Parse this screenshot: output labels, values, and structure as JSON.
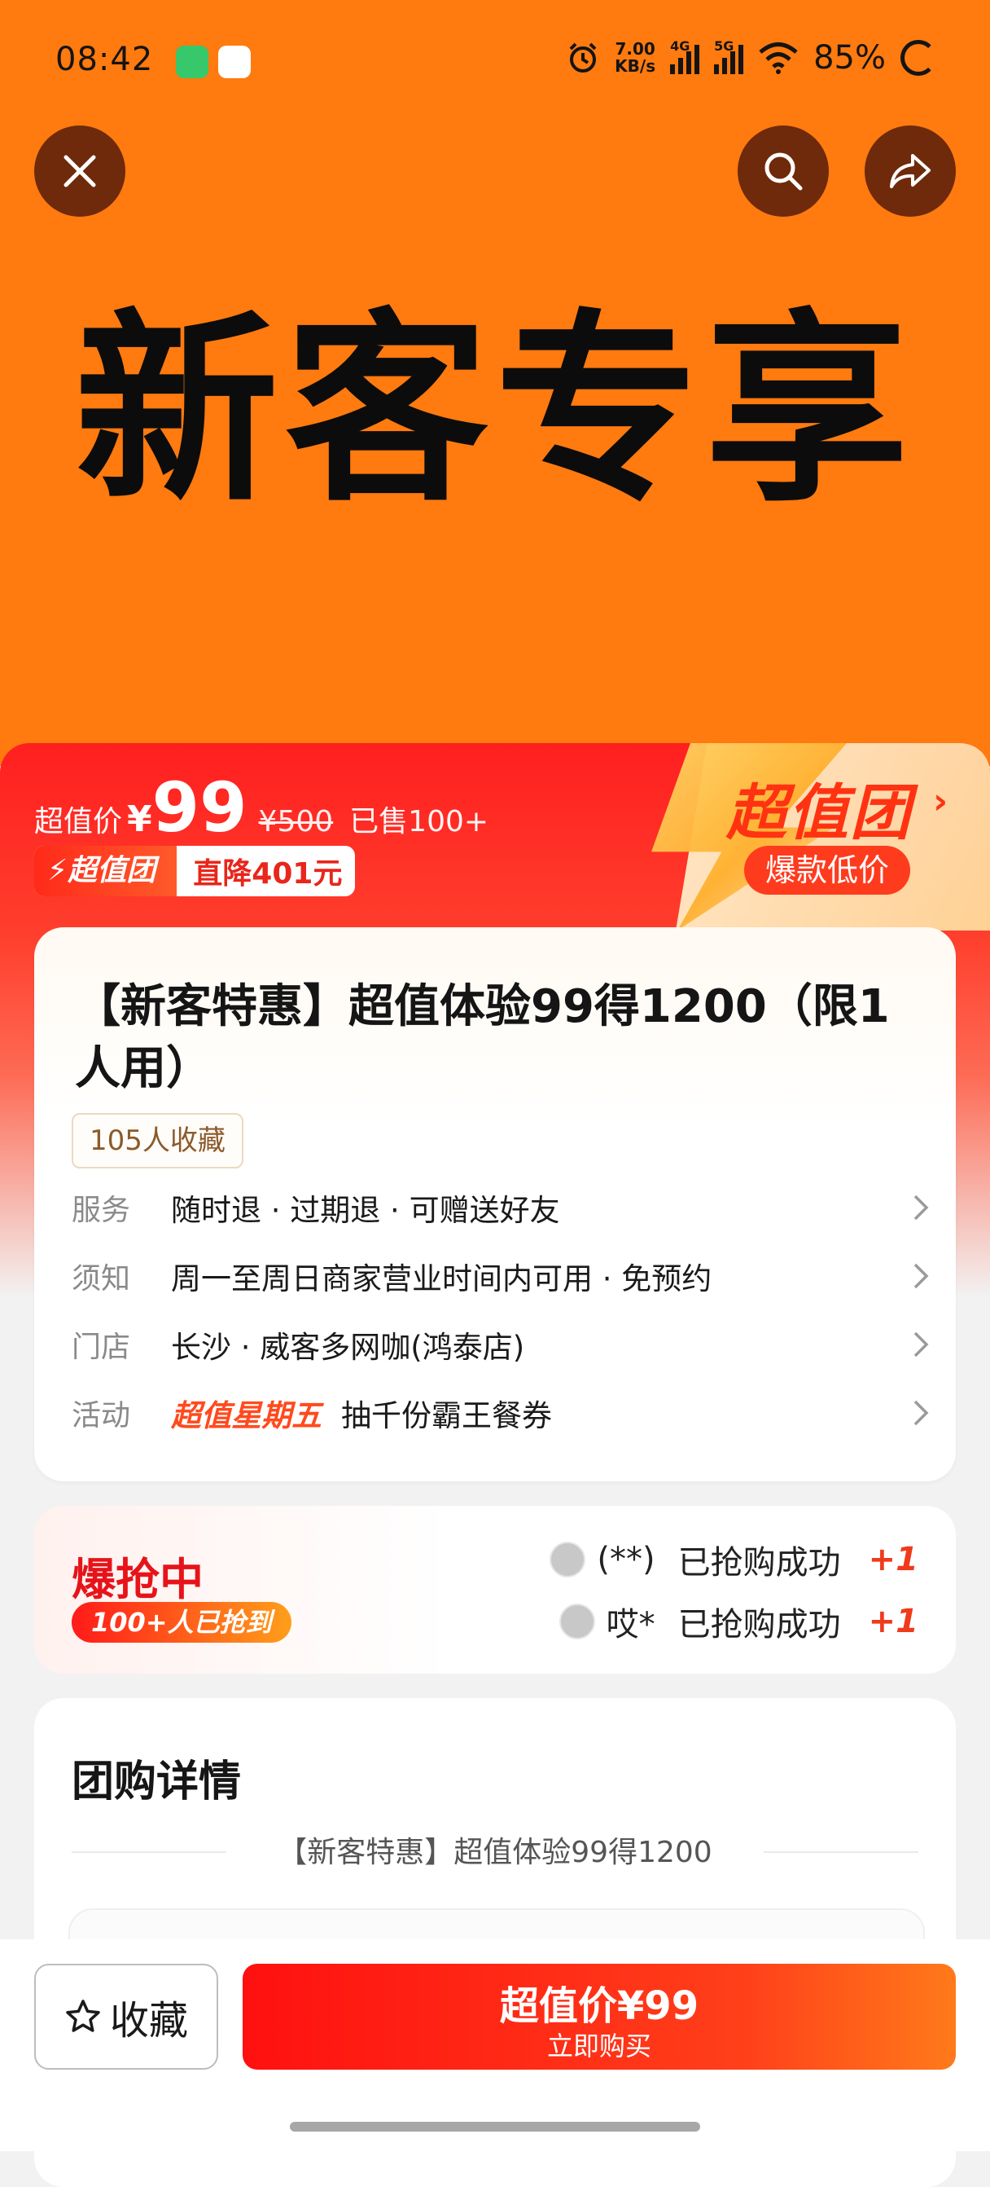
{
  "status_bar": {
    "time": "08:42",
    "net_speed_top": "7.00",
    "net_speed_bottom": "KB/s",
    "sig1": "4G",
    "sig2": "5G",
    "battery": "85%"
  },
  "hero": {
    "title": "新客专享"
  },
  "deal": {
    "price_label": "超值价",
    "yen": "¥",
    "price": "99",
    "original_price": "¥500",
    "sold": "已售100+",
    "brand_tag": "超值团",
    "discount_tag": "直降401元",
    "badge_title": "超值团",
    "badge_sub": "爆款低价"
  },
  "product": {
    "title": "【新客特惠】超值体验99得1200（限1人用）",
    "favorites_chip": "105人收藏",
    "rows": [
      {
        "label": "服务",
        "value": "随时退 · 过期退 · 可赠送好友"
      },
      {
        "label": "须知",
        "value": "周一至周日商家营业时间内可用 · 免预约"
      },
      {
        "label": "门店",
        "value": "长沙 · 威客多网咖(鸿泰店)"
      },
      {
        "label": "活动",
        "highlight": "超值星期五",
        "value": "抽千份霸王餐券"
      }
    ]
  },
  "rush": {
    "title": "爆抢中",
    "pill": "100+人已抢到",
    "items": [
      {
        "name": "(**)",
        "text": "已抢购成功",
        "plus": "+1"
      },
      {
        "name": "哎*",
        "text": "已抢购成功",
        "plus": "+1"
      }
    ]
  },
  "details": {
    "title": "团购详情",
    "subtitle": "【新客特惠】超值体验99得1200"
  },
  "bottom": {
    "favorite_label": "收藏",
    "buy_main": "超值价¥99",
    "buy_sub": "立即购买"
  },
  "colors": {
    "hero_bg": "#ff7a0f",
    "deal_red": "#ff1f1f",
    "accent": "#ff3312"
  }
}
